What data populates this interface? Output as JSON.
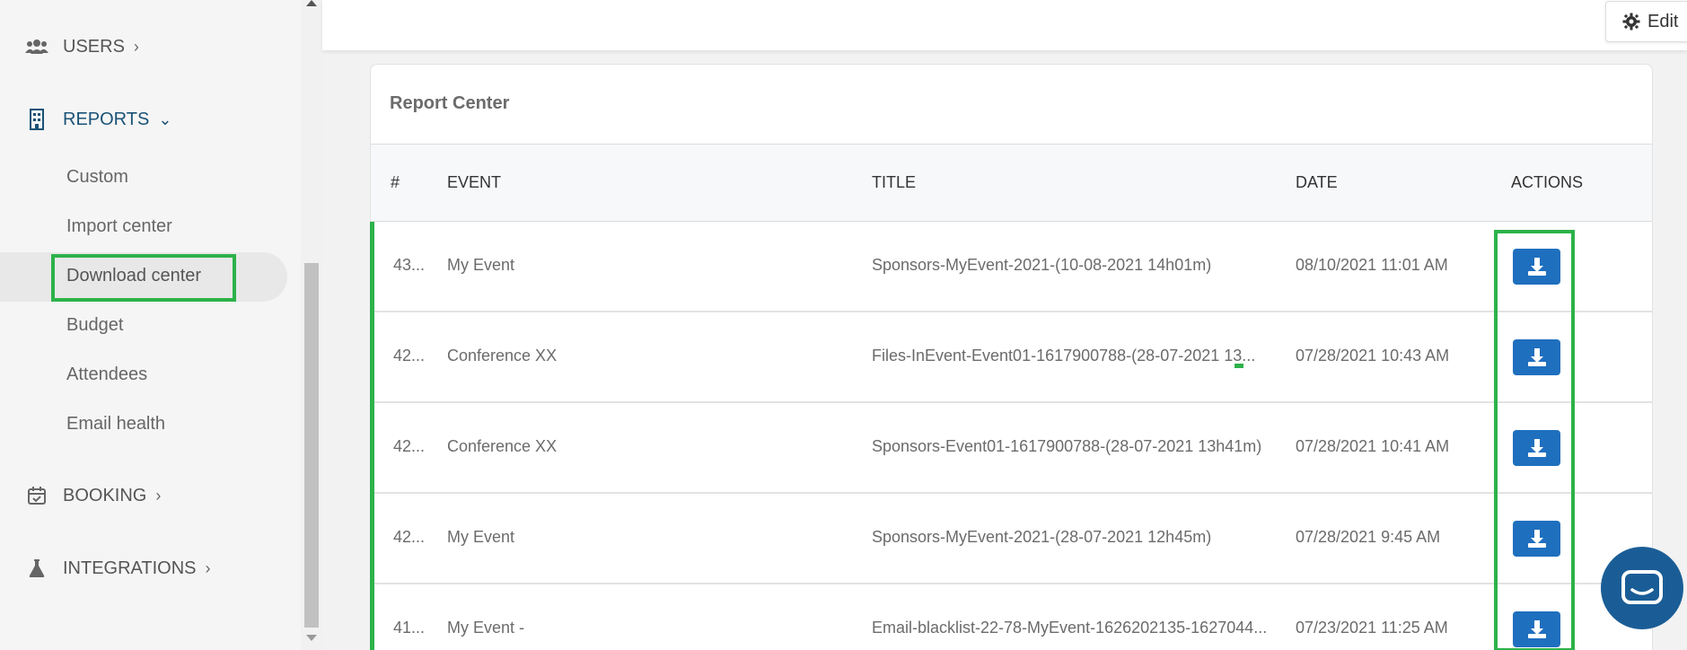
{
  "sidebar": {
    "users": {
      "label": "USERS",
      "icon": "users-icon"
    },
    "reports": {
      "label": "REPORTS",
      "icon": "building-icon",
      "items": [
        "Custom",
        "Import center",
        "Download center",
        "Budget",
        "Attendees",
        "Email health"
      ],
      "active_item": "Download center"
    },
    "booking": {
      "label": "BOOKING",
      "icon": "calendar-check-icon"
    },
    "integrations": {
      "label": "INTEGRATIONS",
      "icon": "flask-icon"
    }
  },
  "header": {
    "edit_label": "Edit",
    "edit_icon": "gear-icon"
  },
  "report_center": {
    "title": "Report Center",
    "columns": [
      "#",
      "EVENT",
      "TITLE",
      "DATE",
      "ACTIONS"
    ],
    "rows": [
      {
        "id": "43...",
        "event": "My Event",
        "title": "Sponsors-MyEvent-2021-(10-08-2021 14h01m)",
        "date": "08/10/2021 11:01 AM"
      },
      {
        "id": "42...",
        "event": "Conference XX",
        "title": "Files-InEvent-Event01-1617900788-(28-07-2021 13...",
        "date": "07/28/2021 10:43 AM"
      },
      {
        "id": "42...",
        "event": "Conference XX",
        "title": "Sponsors-Event01-1617900788-(28-07-2021 13h41m)",
        "date": "07/28/2021 10:41 AM"
      },
      {
        "id": "42...",
        "event": "My Event",
        "title": "Sponsors-MyEvent-2021-(28-07-2021 12h45m)",
        "date": "07/28/2021 9:45 AM"
      },
      {
        "id": "41...",
        "event": "My Event -",
        "title": "Email-blacklist-22-78-MyEvent-1626202135-1627044...",
        "date": "07/23/2021 11:25 AM"
      }
    ]
  },
  "colors": {
    "accent_blue": "#1f6fbf",
    "nav_active": "#1a5276",
    "highlight_green": "#2db24a",
    "chat_bubble": "#1a5d96"
  }
}
